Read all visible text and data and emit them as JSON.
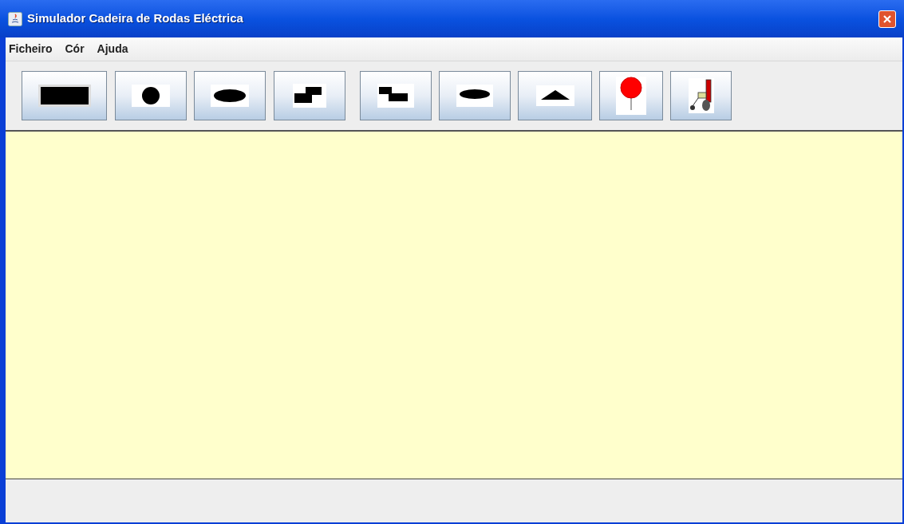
{
  "window": {
    "title": "Simulador Cadeira de Rodas Eléctrica"
  },
  "menu": [
    "Ficheiro",
    "Cór",
    "Ajuda"
  ],
  "tools": [
    {
      "kind": "rectangle"
    },
    {
      "kind": "circle"
    },
    {
      "kind": "ellipse"
    },
    {
      "kind": "step-up"
    },
    {
      "kind": "step-down"
    },
    {
      "kind": "flat-ellipse"
    },
    {
      "kind": "triangle"
    },
    {
      "kind": "pin"
    },
    {
      "kind": "wheelchair"
    }
  ]
}
